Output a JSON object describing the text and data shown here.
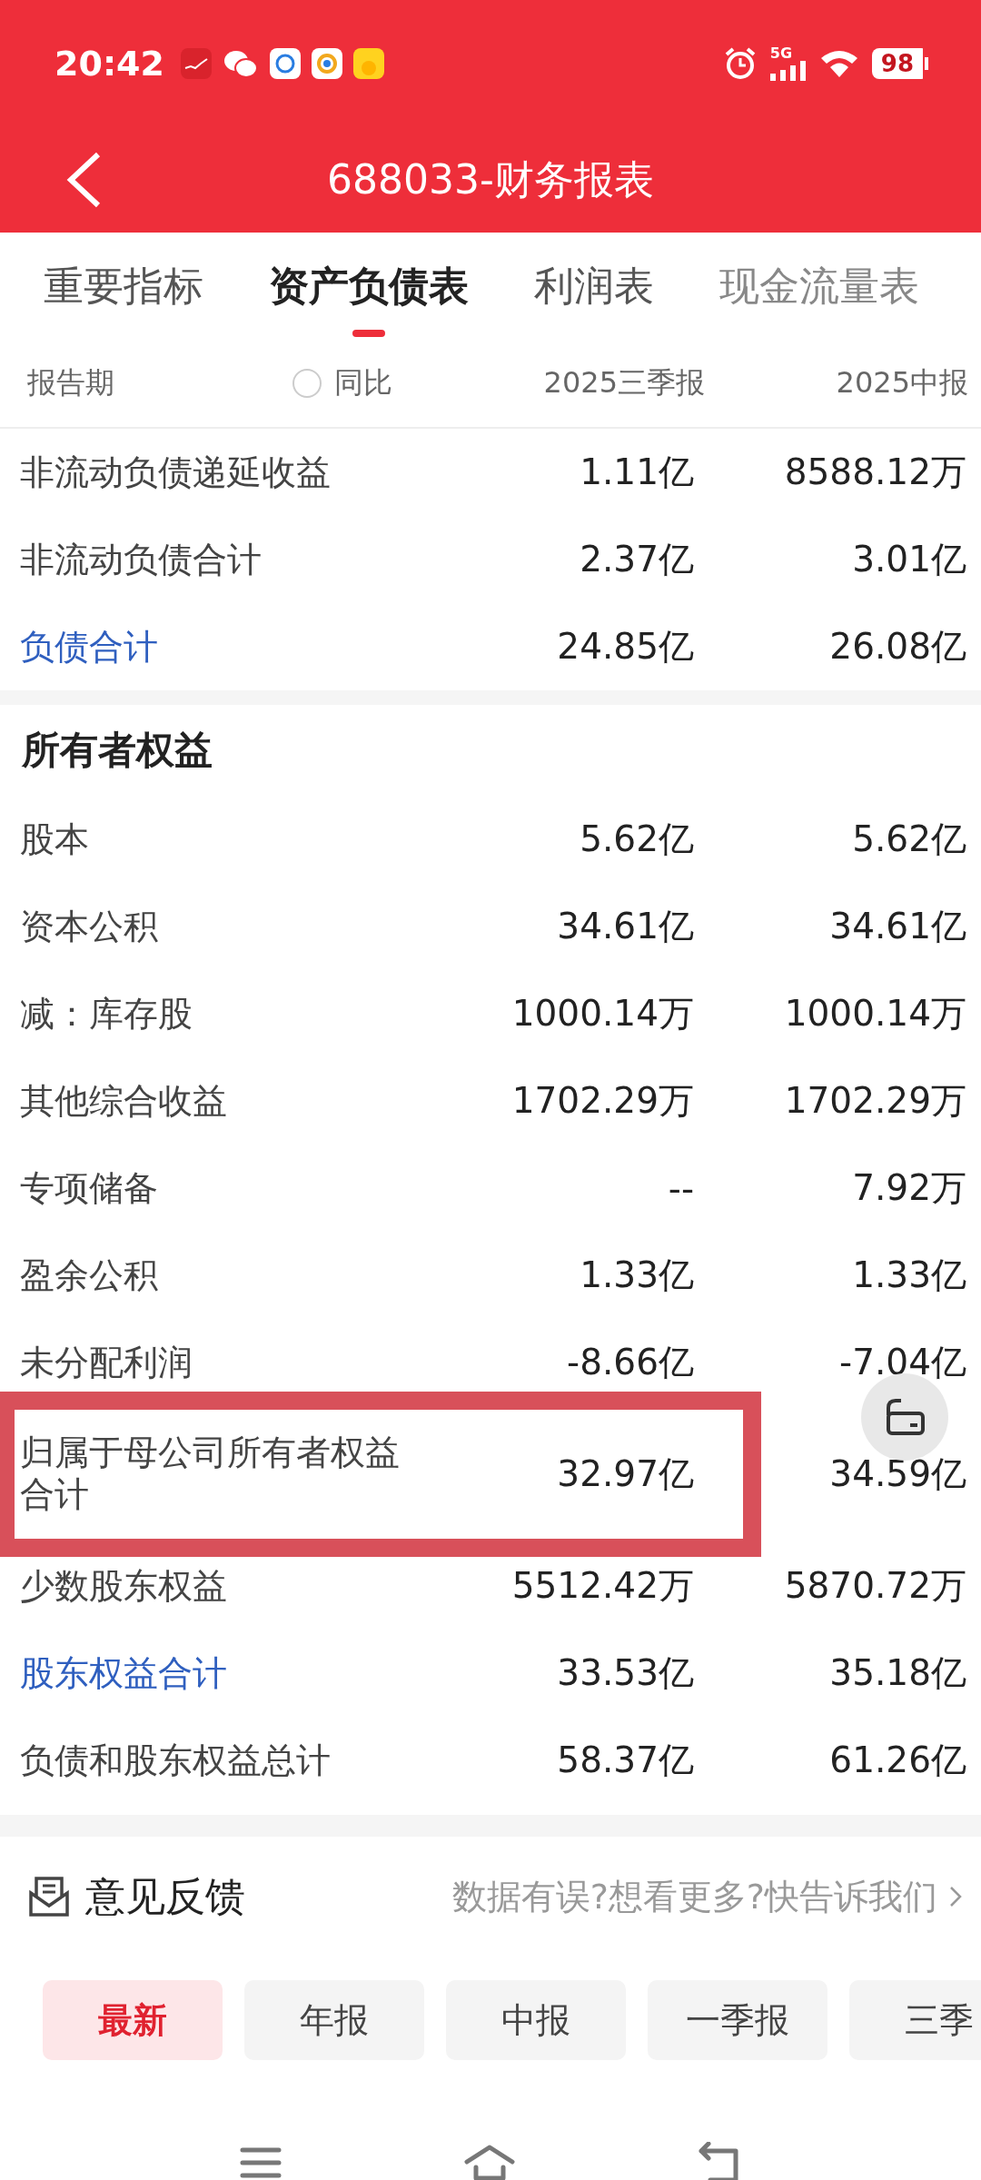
{
  "status_bar": {
    "time": "20:42",
    "network": "5G",
    "battery": "98"
  },
  "header": {
    "title": "688033-财务报表"
  },
  "tabs": [
    {
      "label": "重要指标",
      "selected": false
    },
    {
      "label": "资产负债表",
      "selected": true
    },
    {
      "label": "利润表",
      "selected": false
    },
    {
      "label": "现金流量表",
      "selected": false
    }
  ],
  "table": {
    "columns": [
      "报告期",
      "2025三季报",
      "2025中报"
    ],
    "yoy_toggle": {
      "label": "同比",
      "checked": false
    },
    "rows": [
      {
        "kind": "row",
        "label": "非流动负债递延收益",
        "values": [
          "1.11亿",
          "8588.12万"
        ],
        "total": false,
        "highlighted": false
      },
      {
        "kind": "row",
        "label": "非流动负债合计",
        "values": [
          "2.37亿",
          "3.01亿"
        ],
        "total": false,
        "highlighted": false
      },
      {
        "kind": "row",
        "label": "负债合计",
        "values": [
          "24.85亿",
          "26.08亿"
        ],
        "total": true,
        "highlighted": false
      },
      {
        "kind": "section",
        "label": "所有者权益"
      },
      {
        "kind": "row",
        "label": "股本",
        "values": [
          "5.62亿",
          "5.62亿"
        ],
        "total": false,
        "highlighted": false
      },
      {
        "kind": "row",
        "label": "资本公积",
        "values": [
          "34.61亿",
          "34.61亿"
        ],
        "total": false,
        "highlighted": false
      },
      {
        "kind": "row",
        "label": "减：库存股",
        "values": [
          "1000.14万",
          "1000.14万"
        ],
        "total": false,
        "highlighted": false
      },
      {
        "kind": "row",
        "label": "其他综合收益",
        "values": [
          "1702.29万",
          "1702.29万"
        ],
        "total": false,
        "highlighted": false
      },
      {
        "kind": "row",
        "label": "专项储备",
        "values": [
          "--",
          "7.92万"
        ],
        "total": false,
        "highlighted": false
      },
      {
        "kind": "row",
        "label": "盈余公积",
        "values": [
          "1.33亿",
          "1.33亿"
        ],
        "total": false,
        "highlighted": false
      },
      {
        "kind": "row",
        "label": "未分配利润",
        "values": [
          "-8.66亿",
          "-7.04亿"
        ],
        "total": false,
        "highlighted": false
      },
      {
        "kind": "row",
        "label": "归属于母公司所有者权益合计",
        "values": [
          "32.97亿",
          "34.59亿"
        ],
        "total": false,
        "highlighted": true
      },
      {
        "kind": "row",
        "label": "少数股东权益",
        "values": [
          "5512.42万",
          "5870.72万"
        ],
        "total": false,
        "highlighted": false
      },
      {
        "kind": "row",
        "label": "股东权益合计",
        "values": [
          "33.53亿",
          "35.18亿"
        ],
        "total": true,
        "highlighted": false
      },
      {
        "kind": "row",
        "label": "负债和股东权益总计",
        "values": [
          "58.37亿",
          "61.26亿"
        ],
        "total": false,
        "highlighted": false
      }
    ]
  },
  "feedback": {
    "title": "意见反馈",
    "prompt": "数据有误?想看更多?快告诉我们"
  },
  "period_filters": [
    {
      "label": "最新",
      "selected": true
    },
    {
      "label": "年报",
      "selected": false
    },
    {
      "label": "中报",
      "selected": false
    },
    {
      "label": "一季报",
      "selected": false
    },
    {
      "label": "三季",
      "selected": false
    }
  ]
}
